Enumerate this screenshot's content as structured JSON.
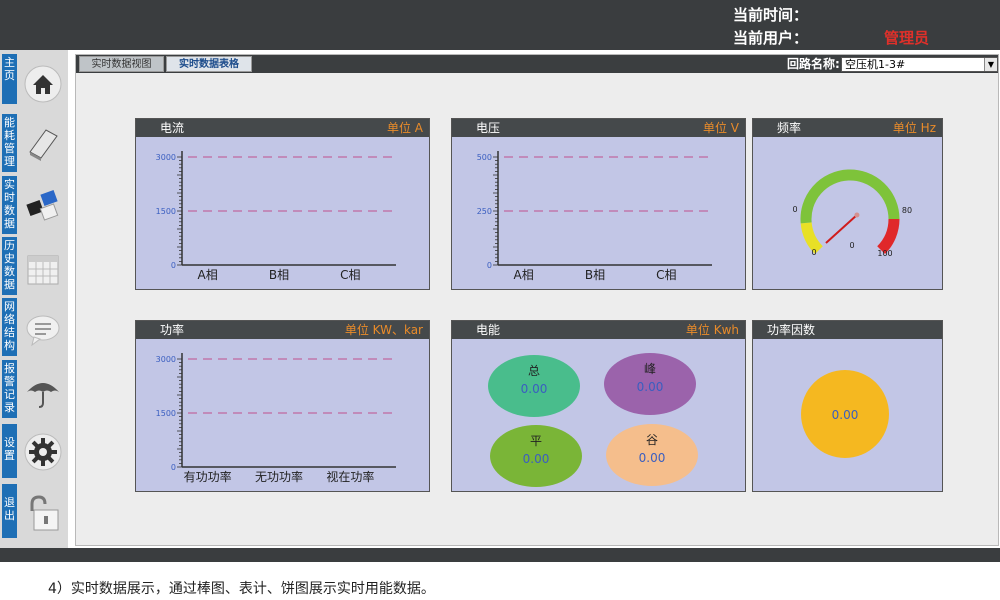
{
  "header": {
    "time_label": "当前时间：",
    "user_label": "当前用户：",
    "user_name": "管理员"
  },
  "sidebar": {
    "items": [
      {
        "label": "主页",
        "icon": "home-icon"
      },
      {
        "label": "能耗管理",
        "icon": "book-icon"
      },
      {
        "label": "实时数据",
        "icon": "cubes-icon"
      },
      {
        "label": "历史数据",
        "icon": "calendar-icon"
      },
      {
        "label": "网络结构",
        "icon": "chat-icon"
      },
      {
        "label": "报警记录",
        "icon": "umbrella-icon"
      },
      {
        "label": "设置",
        "icon": "gear-icon"
      },
      {
        "label": "退出",
        "icon": "unlock-icon"
      }
    ]
  },
  "tabs": [
    {
      "label": "实时数据视图",
      "active": false
    },
    {
      "label": "实时数据表格",
      "active": true
    }
  ],
  "circuit": {
    "label": "回路名称:",
    "selected": "空压机1-3#"
  },
  "colors": {
    "accent_blue": "#1e6fb5",
    "unit_orange": "#e98b2a",
    "admin_red": "#e0302a",
    "card_bg": "#c2c6e6",
    "dash_line": "#c0508f"
  },
  "chart_data": [
    {
      "id": "current",
      "type": "bar",
      "title": "电流",
      "unit_label": "单位 A",
      "categories": [
        "A相",
        "B相",
        "C相"
      ],
      "values": [
        0,
        0,
        0
      ],
      "ylim": [
        0,
        3000
      ],
      "yticks": [
        "0",
        "1500",
        "3000"
      ],
      "reference_lines": [
        1500,
        3000
      ]
    },
    {
      "id": "voltage",
      "type": "bar",
      "title": "电压",
      "unit_label": "单位 V",
      "categories": [
        "A相",
        "B相",
        "C相"
      ],
      "values": [
        0,
        0,
        0
      ],
      "ylim": [
        0,
        500
      ],
      "yticks": [
        "0",
        "250",
        "500"
      ],
      "reference_lines": [
        250,
        500
      ]
    },
    {
      "id": "frequency",
      "type": "gauge",
      "title": "频率",
      "unit_label": "单位 Hz",
      "value": 0,
      "value_label": "0",
      "range": [
        0,
        100
      ],
      "scale_labels": [
        "0",
        "0",
        "80",
        "100"
      ]
    },
    {
      "id": "power",
      "type": "bar",
      "title": "功率",
      "unit_label": "单位 KW、kar",
      "categories": [
        "有功功率",
        "无功功率",
        "视在功率"
      ],
      "values": [
        0,
        0,
        0
      ],
      "ylim": [
        0,
        3000
      ],
      "yticks": [
        "0",
        "1500",
        "3000"
      ],
      "reference_lines": [
        1500,
        3000
      ]
    },
    {
      "id": "energy",
      "type": "pie",
      "title": "电能",
      "unit_label": "单位 Kwh",
      "slices": [
        {
          "name": "总",
          "value": "0.00",
          "color": "#49bd8c"
        },
        {
          "name": "峰",
          "value": "0.00",
          "color": "#9b63ab"
        },
        {
          "name": "平",
          "value": "0.00",
          "color": "#7ab537"
        },
        {
          "name": "谷",
          "value": "0.00",
          "color": "#f5be8c"
        }
      ]
    },
    {
      "id": "power_factor",
      "type": "pie",
      "title": "功率因数",
      "unit_label": "",
      "slices": [
        {
          "name": "",
          "value": "0.00",
          "color": "#f5b820"
        }
      ]
    }
  ],
  "caption": "4）实时数据展示，通过棒图、表计、饼图展示实时用能数据。"
}
